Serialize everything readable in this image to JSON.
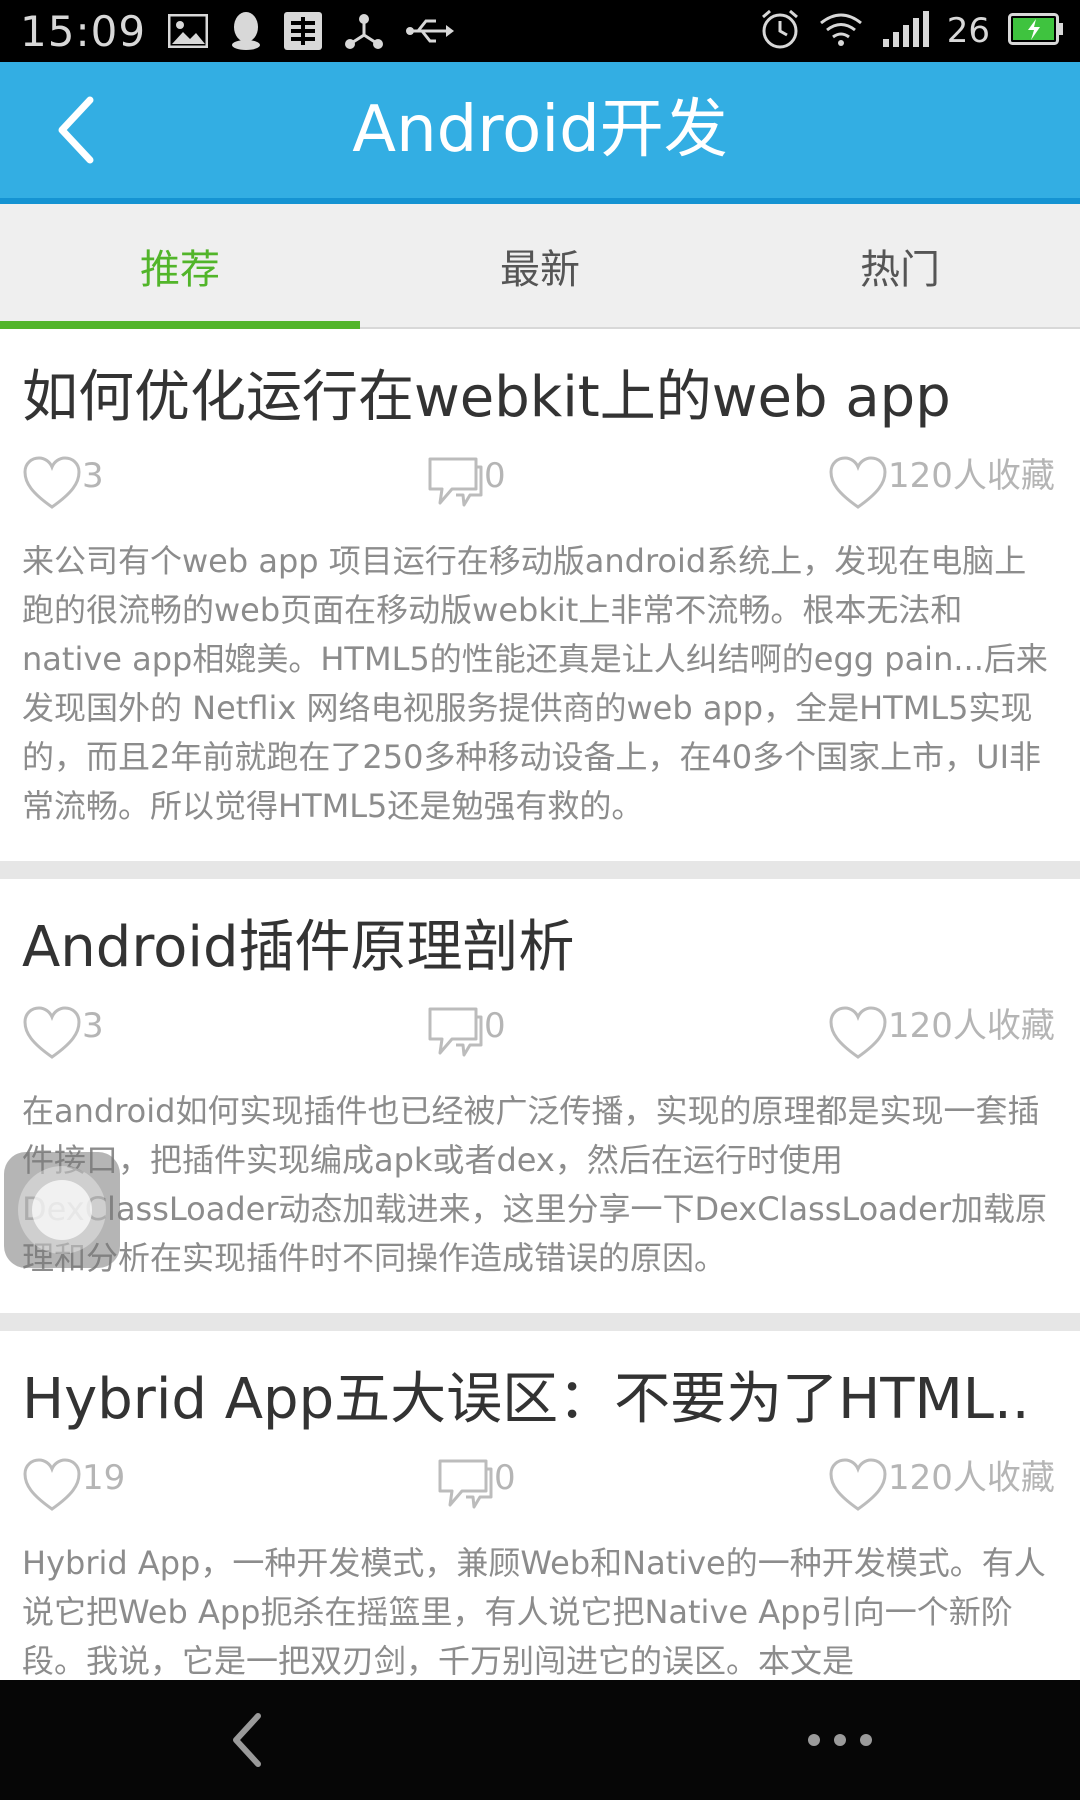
{
  "status_bar": {
    "time": "15:09",
    "signal_level": "26",
    "icons": [
      "image-icon",
      "qq-icon",
      "sogou-icon",
      "share-icon",
      "usb-icon",
      "alarm-icon",
      "wifi-icon",
      "signal-icon",
      "battery-icon"
    ]
  },
  "header": {
    "title": "Android开发",
    "back_icon": "chevron-left-icon",
    "bg_color": "#33aee3"
  },
  "tabs": [
    {
      "label": "推荐",
      "active": true
    },
    {
      "label": "最新",
      "active": false
    },
    {
      "label": "热门",
      "active": false
    }
  ],
  "accent_color": "#52b52a",
  "articles": [
    {
      "title": "如何优化运行在webkit上的web app",
      "likes": "3",
      "comments": "0",
      "favorites": "120人收藏",
      "excerpt": "来公司有个web app 项目运行在移动版android系统上，发现在电脑上跑的很流畅的web页面在移动版webkit上非常不流畅。根本无法和native app相媲美。HTML5的性能还真是让人纠结啊的egg pain...后来发现国外的 Netflix 网络电视服务提供商的web app，全是HTML5实现的，而且2年前就跑在了250多种移动设备上，在40多个国家上市，UI非常流畅。所以觉得HTML5还是勉强有救的。"
    },
    {
      "title": "Android插件原理剖析",
      "likes": "3",
      "comments": "0",
      "favorites": "120人收藏",
      "excerpt": "在android如何实现插件也已经被广泛传播，实现的原理都是实现一套插件接口，把插件实现编成apk或者dex，然后在运行时使用DexClassLoader动态加载进来，这里分享一下DexClassLoader加载原理和分析在实现插件时不同操作造成错误的原因。"
    },
    {
      "title": "Hybrid App五大误区：不要为了HTML..",
      "likes": "19",
      "comments": "0",
      "favorites": "120人收藏",
      "excerpt": "Hybrid App，一种开发模式，兼顾Web和Native的一种开发模式。有人说它把Web App扼杀在摇篮里，有人说它把Native App引向一个新阶段。我说，它是一把双刃剑，千万别闯进它的误区。本文是"
    }
  ],
  "nav_bar": {
    "back_icon": "nav-back-icon",
    "more_icon": "more-dots-icon"
  }
}
